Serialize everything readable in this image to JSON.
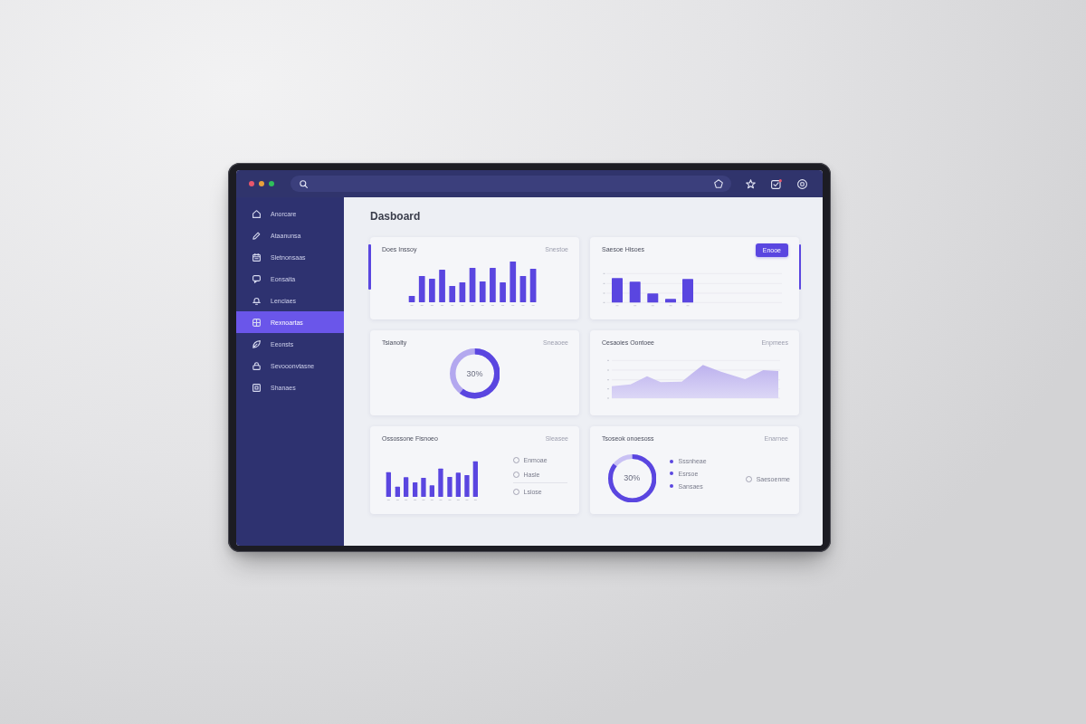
{
  "window_controls": [
    {
      "color": "#e8566c"
    },
    {
      "color": "#e9a13b"
    },
    {
      "color": "#2fbf5b"
    }
  ],
  "sidebar": {
    "items": [
      {
        "label": "Anorcare",
        "selected": false
      },
      {
        "label": "Ataanunsa",
        "selected": false
      },
      {
        "label": "Sletnonsaas",
        "selected": false
      },
      {
        "label": "Eonsaita",
        "selected": false
      },
      {
        "label": "Lenciaes",
        "selected": false
      },
      {
        "label": "Rexnoartas",
        "selected": true
      },
      {
        "label": "Eeonsts",
        "selected": false
      },
      {
        "label": "Sevooonvtasne",
        "selected": false
      },
      {
        "label": "Shanaes",
        "selected": false
      }
    ]
  },
  "page_title": "Dasboard",
  "cards": [
    {
      "kind": "bar_chart",
      "title": "Does Inssoy",
      "link": "Snestoe",
      "accent_left": true
    },
    {
      "kind": "grid_bar_chart",
      "title": "Saesoe Hisoes",
      "button": "Enooe",
      "accent_right": true
    },
    {
      "kind": "ring",
      "title": "Tsianolty",
      "link": "Sneaoee",
      "ring": {
        "level": 0.6,
        "reading": "30%"
      }
    },
    {
      "kind": "area_chart",
      "title": "Cesaoies Oontoee",
      "link": "Enpmees"
    },
    {
      "kind": "bars_options",
      "title": "Ossossone Fisnoeo",
      "link": "Sleasee",
      "options": [
        {
          "label": "Enmoae",
          "selected": false
        },
        {
          "label": "Hasle",
          "selected": false
        },
        {
          "label": "Lsiose",
          "selected": false
        }
      ]
    },
    {
      "kind": "ring_legend",
      "title": "Tsoseok onoesoss",
      "link": "Enarnee",
      "ring": {
        "level": 0.85,
        "reading": "30%"
      },
      "legend": [
        "Sssnheae",
        "Esrsoe",
        "Sansaes"
      ],
      "options": [
        {
          "label": "Saesoenme",
          "selected": false
        }
      ]
    }
  ]
}
